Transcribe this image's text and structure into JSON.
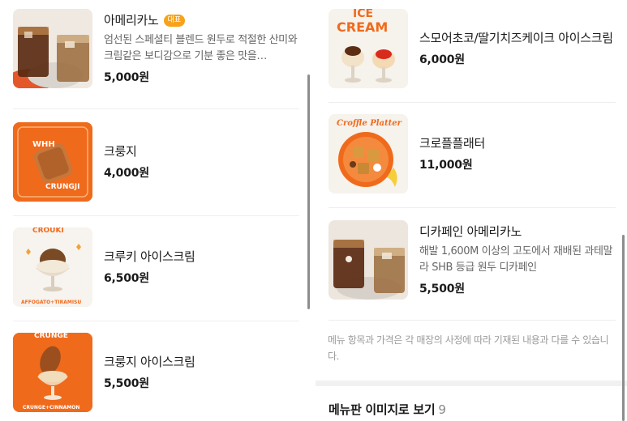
{
  "left_column": {
    "items": [
      {
        "name": "아메리카노",
        "badge": "대표",
        "description": "엄선된 스페셜티 블렌드 원두로 적절한 산미와 크림같은 보디감으로 기분 좋은 맛을…",
        "price": "5,000원",
        "thumb_text": []
      },
      {
        "name": "크룽지",
        "price": "4,000원",
        "thumb_text": [
          "WHH",
          "CRUNGJI"
        ]
      },
      {
        "name": "크루키 아이스크림",
        "price": "6,500원",
        "thumb_text": [
          "CROUKI",
          "AFFOGATO+TIRAMISU"
        ]
      },
      {
        "name": "크룽지 아이스크림",
        "price": "5,500원",
        "thumb_text": [
          "CRUNGE",
          "CRUNGE+CINNAMON"
        ]
      }
    ]
  },
  "right_column": {
    "items": [
      {
        "name": "스모어초코/딸기치즈케이크 아이스크림",
        "price": "6,000원",
        "thumb_text": [
          "ICE",
          "CREAM"
        ]
      },
      {
        "name": "크로플플래터",
        "price": "11,000원",
        "thumb_text": [
          "Croffle Platter"
        ]
      },
      {
        "name": "디카페인 아메리카노",
        "description": "해발 1,600M 이상의 고도에서 재배된 과테말라 SHB 등급 원두 디카페인",
        "price": "5,500원",
        "thumb_text": []
      }
    ],
    "notice": "메뉴 항목과 가격은 각 매장의 사정에 따라 기재된 내용과 다를 수 있습니다.",
    "section_title": "메뉴판 이미지로 보기",
    "section_count": "9"
  },
  "colors": {
    "accent_orange": "#f06a1c",
    "badge": "#f7a21b",
    "price_text": "#1a1a1a",
    "muted_text": "#9a9a9a"
  }
}
